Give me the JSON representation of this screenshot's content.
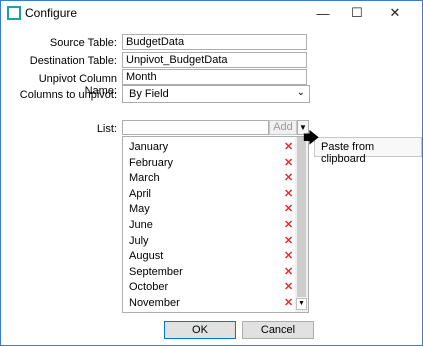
{
  "window": {
    "title": "Configure",
    "minimize_glyph": "—",
    "maximize_glyph": "☐",
    "close_glyph": "✕"
  },
  "form": {
    "source_table_label": "Source Table:",
    "source_table_value": "BudgetData",
    "destination_table_label": "Destination Table:",
    "destination_table_value": "Unpivot_BudgetData",
    "unpivot_column_label": "Unpivot Column Name:",
    "unpivot_column_value": "Month",
    "columns_to_unpivot_label": "Columns to unpivot:",
    "columns_to_unpivot_value": "By Field"
  },
  "list": {
    "label": "List:",
    "add_label": "Add",
    "dropdown_glyph": "▼",
    "remove_glyph": "✕",
    "items": [
      "January",
      "February",
      "March",
      "April",
      "May",
      "June",
      "July",
      "August",
      "September",
      "October",
      "November"
    ]
  },
  "popup": {
    "paste_label": "Paste from clipboard"
  },
  "buttons": {
    "ok": "OK",
    "cancel": "Cancel"
  },
  "colors": {
    "window_border": "#3a7bd5",
    "remove_icon": "#e03030",
    "app_icon": "#1aa3a3"
  }
}
